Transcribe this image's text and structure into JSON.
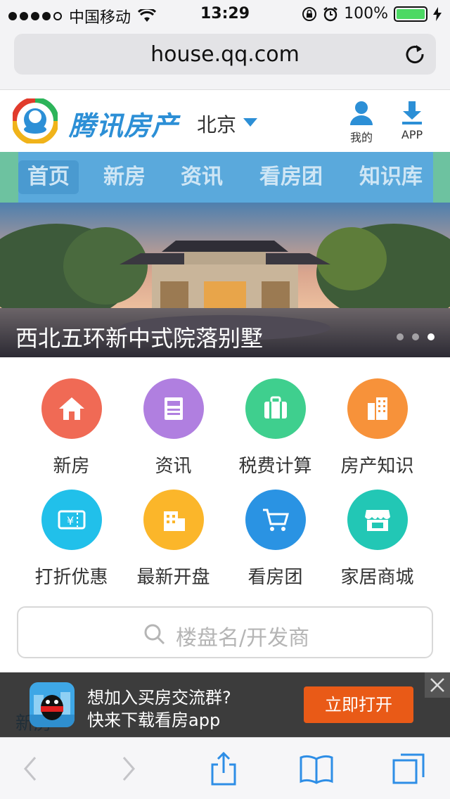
{
  "status_bar": {
    "carrier": "中国移动",
    "time": "13:29",
    "battery": "100%"
  },
  "browser": {
    "url": "house.qq.com"
  },
  "header": {
    "brand": "腾讯房产",
    "city": "北京",
    "my_label": "我的",
    "app_label": "APP"
  },
  "nav": {
    "items": [
      "首页",
      "新房",
      "资讯",
      "看房团",
      "知识库"
    ]
  },
  "banner": {
    "caption": "西北五环新中式院落别墅"
  },
  "grid": {
    "items": [
      {
        "label": "新房",
        "icon": "house-icon",
        "color": "#f06a55"
      },
      {
        "label": "资讯",
        "icon": "news-icon",
        "color": "#b07fe0"
      },
      {
        "label": "税费计算",
        "icon": "briefcase-icon",
        "color": "#3fcf8e"
      },
      {
        "label": "房产知识",
        "icon": "building-icon",
        "color": "#f7923a"
      },
      {
        "label": "打折优惠",
        "icon": "coupon-icon",
        "color": "#21c0ea"
      },
      {
        "label": "最新开盘",
        "icon": "building-open-icon",
        "color": "#fbb62a"
      },
      {
        "label": "看房团",
        "icon": "cart-icon",
        "color": "#2a93e3"
      },
      {
        "label": "家居商城",
        "icon": "store-icon",
        "color": "#22c7b5"
      }
    ]
  },
  "search": {
    "placeholder": "楼盘名/开发商"
  },
  "peek": {
    "text": "新房"
  },
  "promo": {
    "line1": "想加入买房交流群?",
    "line2": "快来下载看房app",
    "button": "立即打开"
  }
}
